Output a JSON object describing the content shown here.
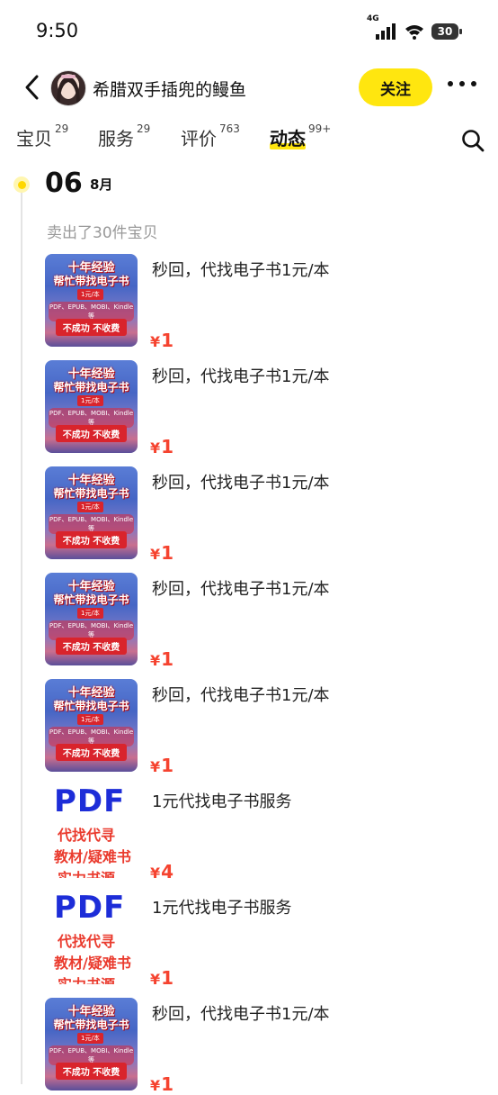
{
  "status_bar": {
    "time": "9:50",
    "network": "4G",
    "battery": "30"
  },
  "header": {
    "shop_name": "希腊双手插兜的鳗鱼",
    "follow_label": "关注"
  },
  "tabs": [
    {
      "label": "宝贝",
      "count": "29"
    },
    {
      "label": "服务",
      "count": "29"
    },
    {
      "label": "评价",
      "count": "763"
    },
    {
      "label": "动态",
      "count": "99+",
      "active": true
    }
  ],
  "timeline": {
    "day": "06",
    "month": "8月",
    "sold_text": "卖出了30件宝贝"
  },
  "book_thumb": {
    "line1": "十年经验",
    "line2": "帮忙带找电子书",
    "price_tag": "1元/本",
    "formats": "PDF、EPUB、MOBI、Kindle等",
    "promise": "不成功 不收费"
  },
  "pdf_thumb": {
    "line1": "PDF",
    "line2": "代找代寻",
    "line3": "教材/疑难书",
    "line4": "实力书源"
  },
  "items": [
    {
      "thumb": "book",
      "title": "秒回，代找电子书1元/本",
      "currency": "¥",
      "price": "1"
    },
    {
      "thumb": "book",
      "title": "秒回，代找电子书1元/本",
      "currency": "¥",
      "price": "1"
    },
    {
      "thumb": "book",
      "title": "秒回，代找电子书1元/本",
      "currency": "¥",
      "price": "1"
    },
    {
      "thumb": "book",
      "title": "秒回，代找电子书1元/本",
      "currency": "¥",
      "price": "1"
    },
    {
      "thumb": "book",
      "title": "秒回，代找电子书1元/本",
      "currency": "¥",
      "price": "1"
    },
    {
      "thumb": "pdf",
      "title": "1元代找电子书服务",
      "currency": "¥",
      "price": "4"
    },
    {
      "thumb": "pdf",
      "title": "1元代找电子书服务",
      "currency": "¥",
      "price": "1"
    },
    {
      "thumb": "book",
      "title": "秒回，代找电子书1元/本",
      "currency": "¥",
      "price": "1"
    }
  ],
  "colors": {
    "accent_yellow": "#ffe60f",
    "price_red": "#f5432f"
  }
}
